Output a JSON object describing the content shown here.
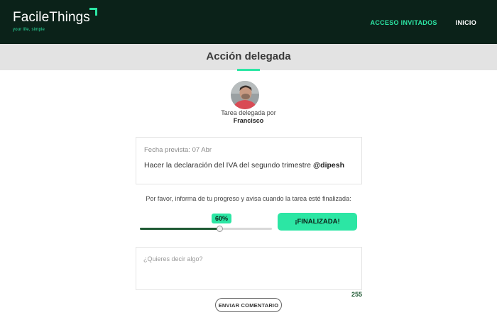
{
  "header": {
    "logo_text": "FacileThings",
    "tagline": "your life, simple",
    "nav": [
      {
        "label": "ACCESO INVITADOS"
      },
      {
        "label": "INICIO"
      }
    ]
  },
  "page": {
    "title": "Acción delegada"
  },
  "delegation": {
    "label": "Tarea delegada por",
    "delegator_name": "Francisco"
  },
  "task": {
    "due_date": "Fecha prevista: 07 Abr",
    "description": "Hacer la declaración del IVA del segundo trimestre",
    "mention": "@dipesh"
  },
  "progress": {
    "instructions": "Por favor, informa de tu progreso y avisa cuando la tarea esté finalizada:",
    "percent_label": "60%",
    "value": 0.6,
    "finish_label": "¡FINALIZADA!"
  },
  "comment": {
    "placeholder": "¿Quieres decir algo?",
    "value": "",
    "remaining_chars": "255",
    "send_label": "ENVIAR COMENTARIO"
  },
  "colors": {
    "header_bg": "#0b2219",
    "accent": "#2ce6a4",
    "slider_fill": "#1f5a34",
    "title_band": "#e3e3e3"
  },
  "icons": {
    "avatar": "user-avatar-photo"
  }
}
